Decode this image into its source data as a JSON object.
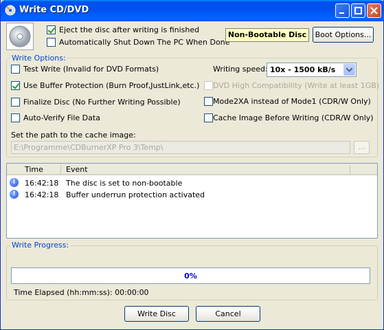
{
  "window": {
    "title": "Write CD/DVD"
  },
  "top": {
    "eject_label": "Eject the disc after writing is finished",
    "eject_checked": true,
    "shutdown_label": "Automatically Shut Down The PC When Done",
    "shutdown_checked": false,
    "boot_status": "Non-Bootable Disc",
    "boot_options_label": "Boot Options..."
  },
  "write_options": {
    "title": "Write Options:",
    "test_write": {
      "label": "Test Write (Invalid for DVD Formats)",
      "checked": false
    },
    "buffer_protection": {
      "label": "Use Buffer Protection (Burn Proof,JustLink,etc.)",
      "checked": true
    },
    "finalize": {
      "label": "Finalize Disc (No Further Writing Possible)",
      "checked": false
    },
    "auto_verify": {
      "label": "Auto-Verify File Data",
      "checked": false
    },
    "writing_speed_label": "Writing speed:",
    "writing_speed_value": "10x - 1500 kB/s",
    "dvd_compat": {
      "label": "DVD High Compatibility (Write at least 1GB)",
      "checked": false,
      "disabled": true
    },
    "mode2xa": {
      "label": "Mode2XA instead of Mode1 (CDR/W Only)",
      "checked": false
    },
    "cache_image": {
      "label": "Cache Image Before Writing (CDR/W Only)",
      "checked": false
    },
    "cache_path_label": "Set the path to the cache image:",
    "cache_path_value": "E:\\Programme\\CDBurnerXP Pro 3\\Temp\\",
    "browse_label": "..."
  },
  "log": {
    "columns": [
      "Time",
      "Event"
    ],
    "rows": [
      {
        "icon": "info-icon",
        "time": "16:42:18",
        "event": "The disc is set to non-bootable"
      },
      {
        "icon": "info-icon",
        "time": "16:42:18",
        "event": "Buffer underrun protection activated"
      }
    ]
  },
  "progress": {
    "title": "Write Progress:",
    "percent": 0,
    "percent_text": "0%",
    "elapsed": "Time Elapsed (hh:mm:ss): 00:00:00"
  },
  "buttons": {
    "write": "Write Disc",
    "cancel": "Cancel"
  }
}
